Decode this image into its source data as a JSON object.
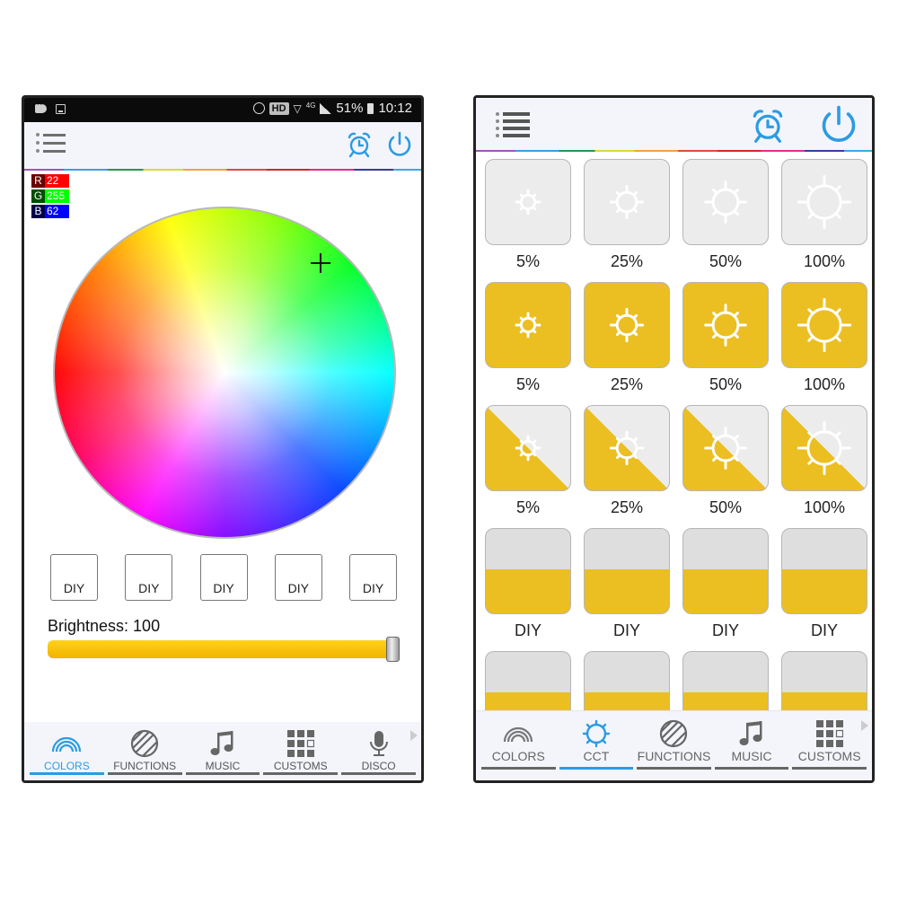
{
  "left_screen": {
    "status_bar": {
      "hd_badge": "HD",
      "network": "4G",
      "battery": "51%",
      "time": "10:12"
    },
    "header": {
      "menu_icon": "menu-list-icon",
      "alarm_icon": "alarm-clock-icon",
      "power_icon": "power-icon",
      "accent_color": "#2b9be3"
    },
    "rgb": {
      "r_label": "R",
      "r_value": "22",
      "g_label": "G",
      "g_value": "255",
      "b_label": "B",
      "b_value": "62"
    },
    "color_wheel": {
      "selected_rgb": [
        22,
        255,
        62
      ]
    },
    "diy_buttons": [
      "DIY",
      "DIY",
      "DIY",
      "DIY",
      "DIY"
    ],
    "brightness": {
      "label": "Brightness: 100",
      "value": 100,
      "max": 100,
      "color": "#f8c20a"
    },
    "nav": {
      "tabs": [
        {
          "label": "COLORS",
          "icon": "rainbow-icon",
          "active": true
        },
        {
          "label": "FUNCTIONS",
          "icon": "striped-circle-icon",
          "active": false
        },
        {
          "label": "MUSIC",
          "icon": "music-note-icon",
          "active": false
        },
        {
          "label": "CUSTOMS",
          "icon": "grid-icon",
          "active": false
        },
        {
          "label": "DISCO",
          "icon": "microphone-icon",
          "active": false
        }
      ],
      "more_icon": "chevron-right-icon"
    }
  },
  "right_screen": {
    "header": {
      "menu_icon": "menu-list-icon",
      "alarm_icon": "alarm-clock-icon",
      "power_icon": "power-icon"
    },
    "cct_rows": [
      {
        "style": "cool",
        "items": [
          "5%",
          "25%",
          "50%",
          "100%"
        ]
      },
      {
        "style": "warm",
        "items": [
          "5%",
          "25%",
          "50%",
          "100%"
        ]
      },
      {
        "style": "mixed",
        "items": [
          "5%",
          "25%",
          "50%",
          "100%"
        ]
      },
      {
        "style": "diy",
        "items": [
          "DIY",
          "DIY",
          "DIY",
          "DIY"
        ]
      },
      {
        "style": "diy",
        "items": [
          "",
          "",
          "",
          ""
        ]
      }
    ],
    "warm_color": "#ebbf22",
    "nav": {
      "tabs": [
        {
          "label": "COLORS",
          "icon": "rainbow-icon",
          "active": false
        },
        {
          "label": "CCT",
          "icon": "sun-gear-icon",
          "active": true
        },
        {
          "label": "FUNCTIONS",
          "icon": "striped-circle-icon",
          "active": false
        },
        {
          "label": "MUSIC",
          "icon": "music-note-icon",
          "active": false
        },
        {
          "label": "CUSTOMS",
          "icon": "grid-icon",
          "active": false
        }
      ],
      "more_icon": "chevron-right-icon"
    }
  }
}
